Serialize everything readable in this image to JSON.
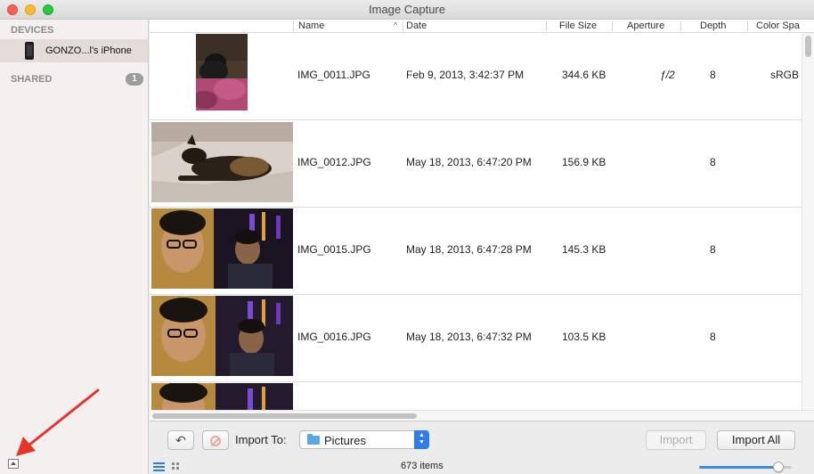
{
  "window": {
    "title": "Image Capture"
  },
  "sidebar": {
    "devices_heading": "DEVICES",
    "device_name": "GONZO...l's iPhone",
    "shared_heading": "SHARED",
    "shared_count": "1"
  },
  "columns": {
    "name": "Name",
    "date": "Date",
    "file_size": "File Size",
    "aperture": "Aperture",
    "depth": "Depth",
    "color_space": "Color Spa"
  },
  "rows": [
    {
      "name": "IMG_0011.JPG",
      "date": "Feb 9, 2013, 3:42:37 PM",
      "size": "344.6 KB",
      "aperture": "ƒ/2",
      "depth": "8",
      "color": "sRGB"
    },
    {
      "name": "IMG_0012.JPG",
      "date": "May 18, 2013, 6:47:20 PM",
      "size": "156.9 KB",
      "aperture": "",
      "depth": "8",
      "color": ""
    },
    {
      "name": "IMG_0015.JPG",
      "date": "May 18, 2013, 6:47:28 PM",
      "size": "145.3 KB",
      "aperture": "",
      "depth": "8",
      "color": ""
    },
    {
      "name": "IMG_0016.JPG",
      "date": "May 18, 2013, 6:47:32 PM",
      "size": "103.5 KB",
      "aperture": "",
      "depth": "8",
      "color": ""
    }
  ],
  "toolbar": {
    "import_to_label": "Import To:",
    "destination": "Pictures",
    "import_label": "Import",
    "import_all_label": "Import All",
    "item_count": "673 items",
    "thumbnail_zoom": 0.9
  },
  "colors": {
    "accent": "#2f7ee6",
    "annotation_arrow": "#e8332a"
  },
  "icons": {
    "device": "iphone-icon",
    "rotate": "rotate-left-icon",
    "delete": "delete-icon",
    "folder": "folder-icon",
    "list_view": "list-view-icon",
    "grid_view": "grid-view-icon"
  }
}
